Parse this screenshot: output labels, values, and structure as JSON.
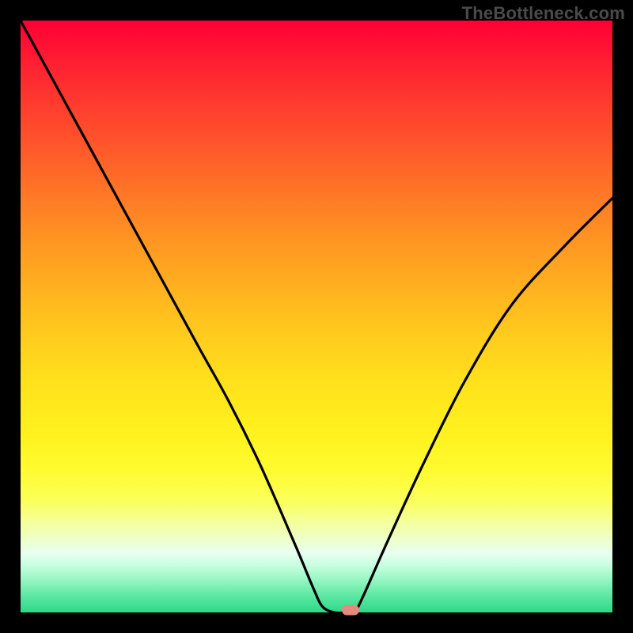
{
  "watermark": "TheBottleneck.com",
  "chart_data": {
    "type": "line",
    "title": "",
    "xlabel": "",
    "ylabel": "",
    "xlim": [
      0,
      100
    ],
    "ylim": [
      0,
      100
    ],
    "grid": false,
    "series": [
      {
        "name": "bottleneck-curve",
        "x": [
          0,
          6,
          12,
          18,
          24,
          30,
          35,
          40,
          44,
          47,
          49.5,
          51,
          53,
          55,
          56.5,
          58,
          62,
          68,
          75,
          83,
          92,
          100
        ],
        "values": [
          100,
          89,
          78,
          67,
          56,
          45,
          36,
          26,
          17,
          10,
          4,
          1,
          0,
          0,
          0.2,
          3,
          12,
          25,
          39,
          52,
          62,
          70
        ]
      }
    ],
    "marker": {
      "x": 55.8,
      "y": 0.4
    },
    "gradient_stops": [
      {
        "pct": 0,
        "color": "#ff0033"
      },
      {
        "pct": 45,
        "color": "#ffb41f"
      },
      {
        "pct": 70,
        "color": "#fff21e"
      },
      {
        "pct": 100,
        "color": "#2dd989"
      }
    ]
  }
}
